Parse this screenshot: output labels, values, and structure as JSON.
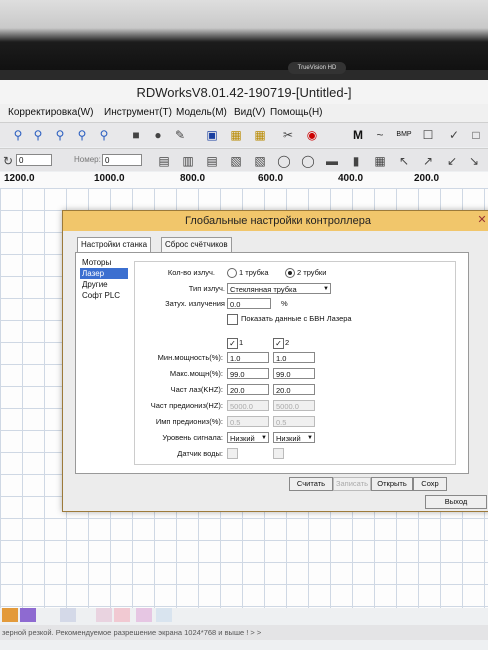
{
  "monitor": {
    "webcam_label": "TrueVision HD"
  },
  "app": {
    "title": "RDWorksV8.01.42-190719-[Untitled-]"
  },
  "menu": [
    "Корректировка(W)",
    "Инструмент(T)",
    "Модель(M)",
    "Вид(V)",
    "Помощь(H)"
  ],
  "toolbar2": {
    "angle_value": "0",
    "number_label": "Номер:",
    "number_value": "0"
  },
  "ruler": [
    "1200.0",
    "1000.0",
    "800.0",
    "600.0",
    "400.0",
    "200.0"
  ],
  "dialog": {
    "title": "Глобальные настройки контроллера",
    "tabs": [
      "Настройки станка",
      "Сброс счётчиков"
    ],
    "nav": [
      "Моторы",
      "Лазер",
      "Другие",
      "Софт PLC"
    ],
    "selected_nav": "Лазер",
    "laser_count_label": "Кол-во излуч.",
    "laser_count_options": [
      "1 трубка",
      "2 трубки"
    ],
    "laser_count_selected": "2 трубки",
    "laser_type_label": "Тип излуч.",
    "laser_type_value": "Стеклянная трубка",
    "attenuation_label": "Затух. излучения",
    "attenuation_value": "0.0",
    "attenuation_unit": "%",
    "show_data_label": "Показать данные с БВН Лазера",
    "col_headers": [
      "1",
      "2"
    ],
    "rows": [
      {
        "label": "Мин.мощность(%):",
        "v1": "1.0",
        "v2": "1.0",
        "enabled": true
      },
      {
        "label": "Макс.мощн(%):",
        "v1": "99.0",
        "v2": "99.0",
        "enabled": true
      },
      {
        "label": "Част лаз(KHZ):",
        "v1": "20.0",
        "v2": "20.0",
        "enabled": true
      },
      {
        "label": "Част предиониз(HZ):",
        "v1": "5000.0",
        "v2": "5000.0",
        "enabled": false
      },
      {
        "label": "Имп предиониз(%):",
        "v1": "0.5",
        "v2": "0.5",
        "enabled": false
      }
    ],
    "signal_level_label": "Уровень сигнала:",
    "signal_level_values": [
      "Низкий",
      "Низкий"
    ],
    "water_sensor_label": "Датчик воды:",
    "buttons": {
      "read": "Считать",
      "write": "Записать",
      "open": "Открыть",
      "save": "Сохр"
    },
    "exit": "Выход"
  },
  "statusbar": {
    "text": "зерной резкой. Рекомендуемое разрешение экрана 1024*768 и выше ! > >"
  },
  "colors": {
    "accent": "#f1c66b",
    "selection": "#3b6fd0"
  }
}
